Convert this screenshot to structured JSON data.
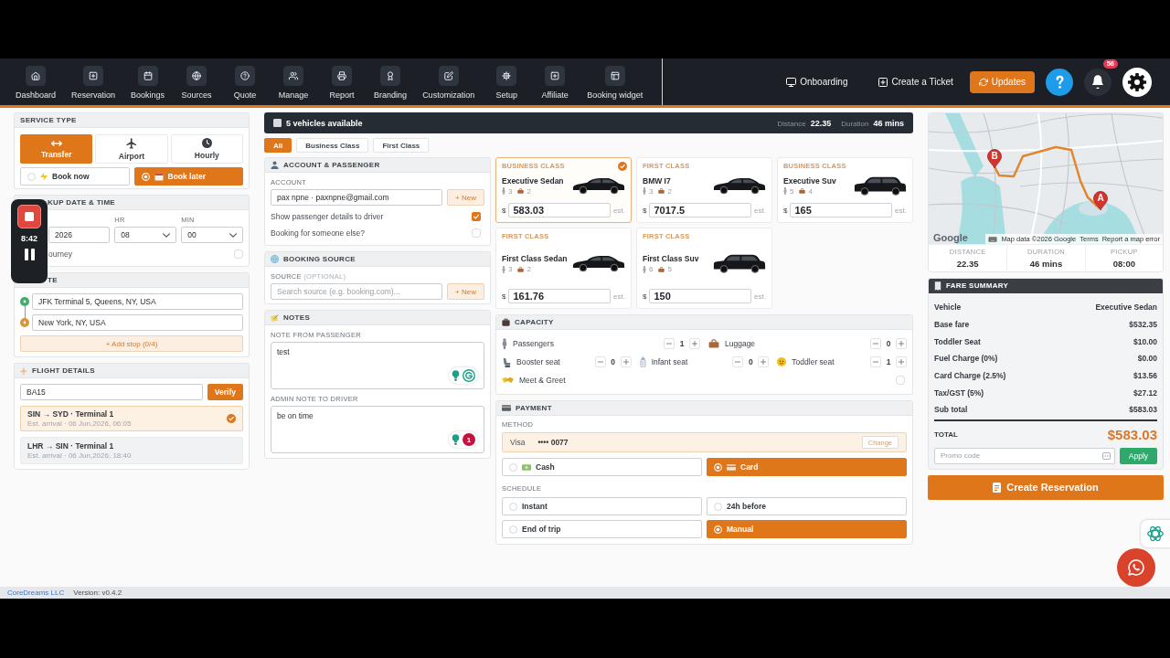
{
  "recorder": {
    "time": "8:42"
  },
  "nav": {
    "items": [
      {
        "label": "Dashboard"
      },
      {
        "label": "Reservation"
      },
      {
        "label": "Bookings"
      },
      {
        "label": "Sources"
      },
      {
        "label": "Quote"
      },
      {
        "label": "Manage"
      },
      {
        "label": "Report"
      },
      {
        "label": "Branding"
      },
      {
        "label": "Customization"
      },
      {
        "label": "Setup"
      },
      {
        "label": "Affiliate"
      },
      {
        "label": "Booking widget"
      }
    ],
    "onboarding": "Onboarding",
    "ticket": "Create a Ticket",
    "updates": "Updates",
    "notification_count": "56"
  },
  "service_type": {
    "title": "SERVICE TYPE",
    "options": [
      {
        "label": "Transfer",
        "selected": true
      },
      {
        "label": "Airport",
        "selected": false
      },
      {
        "label": "Hourly",
        "selected": false
      }
    ],
    "timing": [
      {
        "label": "Book now",
        "selected": false
      },
      {
        "label": "Book later",
        "selected": true
      }
    ]
  },
  "pickup": {
    "title": "KUP DATE & TIME",
    "date": "2026",
    "hour_label": "HR",
    "hour": "08",
    "minute_label": "MIN",
    "minute": "00",
    "return_journey": {
      "label": "ourney",
      "checked": false
    }
  },
  "route": {
    "title": "TE",
    "stops": [
      {
        "value": "JFK Terminal 5, Queens, NY, USA",
        "color": "#3fae6a"
      },
      {
        "value": "New York, NY, USA",
        "color": "#d9953a"
      }
    ],
    "add_stop": "+ Add stop (0/4)"
  },
  "flight": {
    "title": "FLIGHT DETAILS",
    "number": "BA15",
    "verify": "Verify",
    "results": [
      {
        "route": "SIN → SYD · Terminal 1",
        "arrival": "Est. arrival · 06 Jun,2026, 06:05",
        "selected": true
      },
      {
        "route": "LHR → SIN · Terminal 1",
        "arrival": "Est. arrival · 06 Jun,2026, 18:40",
        "selected": false
      }
    ]
  },
  "vehicles": {
    "summary": "5 vehicles available",
    "distance_label": "Distance",
    "distance": "22.35",
    "duration_label": "Duration",
    "duration": "46 mins",
    "filters": [
      {
        "label": "All",
        "selected": true
      },
      {
        "label": "Business Class",
        "selected": false
      },
      {
        "label": "First Class",
        "selected": false
      }
    ],
    "cards": [
      {
        "class": "BUSINESS CLASS",
        "name": "Executive Sedan",
        "kind": "sedan",
        "passengers": "3",
        "luggage": "2",
        "currency": "$",
        "price": "583.03",
        "estimate": "est.",
        "selected": true
      },
      {
        "class": "FIRST CLASS",
        "name": "BMW I7",
        "kind": "sedan",
        "passengers": "3",
        "luggage": "2",
        "currency": "$",
        "price": "7017.5",
        "estimate": "est.",
        "selected": false
      },
      {
        "class": "BUSINESS CLASS",
        "name": "Executive Suv",
        "kind": "suv",
        "passengers": "5",
        "luggage": "4",
        "currency": "$",
        "price": "165",
        "estimate": "est.",
        "selected": false
      },
      {
        "class": "FIRST CLASS",
        "name": "First Class Sedan",
        "kind": "sedan",
        "passengers": "3",
        "luggage": "2",
        "currency": "$",
        "price": "161.76",
        "estimate": "est.",
        "selected": false
      },
      {
        "class": "FIRST CLASS",
        "name": "First Class Suv",
        "kind": "suv",
        "passengers": "6",
        "luggage": "5",
        "currency": "$",
        "price": "150",
        "estimate": "est.",
        "selected": false
      }
    ]
  },
  "account": {
    "title": "ACCOUNT & PASSENGER",
    "account_label": "ACCOUNT",
    "account": "pax npne · paxnpne@gmail.com",
    "new_button": "+ New",
    "options": [
      {
        "label": "Show passenger details to driver",
        "checked": true
      },
      {
        "label": "Booking for someone else?",
        "checked": false
      }
    ]
  },
  "booking_source": {
    "title": "BOOKING SOURCE",
    "label": "SOURCE",
    "label_note": "(OPTIONAL)",
    "placeholder": "Search source (e.g. booking.com)...",
    "new_button": "+ New"
  },
  "notes": {
    "title": "NOTES",
    "fields": [
      {
        "label": "NOTE FROM PASSENGER",
        "value": "test"
      },
      {
        "label": "ADMIN NOTE TO DRIVER",
        "value": "be on time",
        "issues": "1"
      }
    ]
  },
  "capacity": {
    "title": "CAPACITY",
    "rows": [
      [
        {
          "label": "Passengers",
          "value": "1"
        },
        {
          "label": "Luggage",
          "value": "0"
        }
      ],
      [
        {
          "label": "Booster seat",
          "value": "0"
        },
        {
          "label": "Infant seat",
          "value": "0"
        },
        {
          "label": "Toddler seat",
          "value": "1"
        }
      ]
    ],
    "meet_greet": {
      "label": "Meet & Greet",
      "checked": false
    }
  },
  "payment": {
    "title": "PAYMENT",
    "method_label": "METHOD",
    "saved_card": {
      "brand": "Visa",
      "number": "•••• 0077",
      "change": "Change"
    },
    "methods": [
      {
        "label": "Cash",
        "selected": false
      },
      {
        "label": "Card",
        "selected": true
      }
    ],
    "schedule_label": "SCHEDULE",
    "schedule": [
      {
        "label": "Instant",
        "selected": false
      },
      {
        "label": "24h before",
        "selected": false
      },
      {
        "label": "End of trip",
        "selected": false
      },
      {
        "label": "Manual",
        "selected": true
      }
    ]
  },
  "map": {
    "markers": [
      {
        "label": "B"
      },
      {
        "label": "A"
      }
    ],
    "logo": "Google",
    "attribution": "Map data ©2026 Google",
    "terms": "Terms",
    "report": "Report a map error"
  },
  "trip_stats": [
    {
      "label": "DISTANCE",
      "value": "22.35"
    },
    {
      "label": "DURATION",
      "value": "46 mins"
    },
    {
      "label": "PICKUP",
      "value": "08:00"
    }
  ],
  "fare": {
    "title": "FARE SUMMARY",
    "rows": [
      {
        "label": "Vehicle",
        "value": "Executive Sedan"
      },
      {
        "label": "Base fare",
        "value": "$532.35"
      },
      {
        "label": "Toddler Seat",
        "value": "$10.00"
      },
      {
        "label": "Fuel Charge (0%)",
        "value": "$0.00"
      },
      {
        "label": "Card Charge (2.5%)",
        "value": "$13.56"
      },
      {
        "label": "Tax/GST (5%)",
        "value": "$27.12"
      },
      {
        "label": "Sub total",
        "value": "$583.03"
      }
    ],
    "total_label": "TOTAL",
    "total": "$583.03",
    "promo_placeholder": "Promo code",
    "apply": "Apply"
  },
  "create_button": "Create Reservation",
  "footer": {
    "company": "CoreDreams LLC",
    "version": "Version: v0.4.2"
  }
}
